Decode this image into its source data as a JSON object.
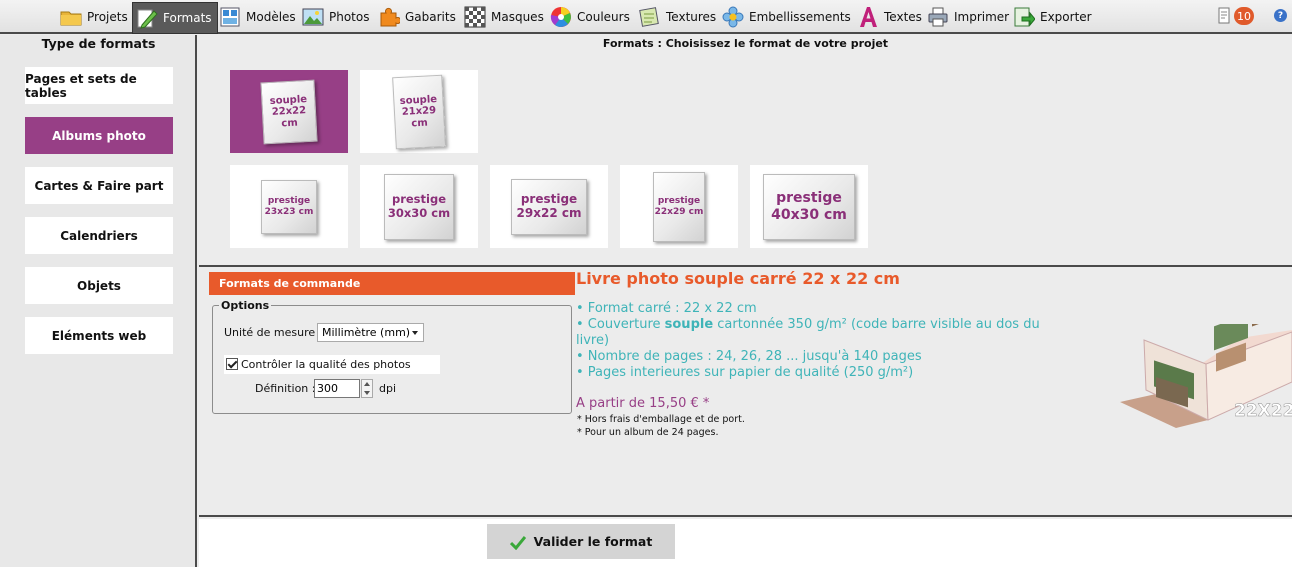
{
  "toolbar": {
    "items": [
      {
        "label": "Projets",
        "icon": "folder-icon"
      },
      {
        "label": "Formats",
        "icon": "formats-pencil-icon",
        "active": true
      },
      {
        "label": "Modèles",
        "icon": "layout-icon"
      },
      {
        "label": "Photos",
        "icon": "picture-icon"
      },
      {
        "label": "Gabarits",
        "icon": "puzzle-icon"
      },
      {
        "label": "Masques",
        "icon": "checkerboard-icon"
      },
      {
        "label": "Couleurs",
        "icon": "color-wheel-icon"
      },
      {
        "label": "Textures",
        "icon": "texture-icon"
      },
      {
        "label": "Embellissements",
        "icon": "flower-icon"
      },
      {
        "label": "Textes",
        "icon": "letter-a-icon"
      },
      {
        "label": "Imprimer",
        "icon": "printer-icon"
      },
      {
        "label": "Exporter",
        "icon": "export-icon"
      }
    ],
    "notifications_count": "10",
    "help_symbol": "?"
  },
  "sidebar": {
    "title": "Type de formats",
    "items": [
      {
        "label": "Pages et sets de tables"
      },
      {
        "label": "Albums photo",
        "active": true
      },
      {
        "label": "Cartes & Faire part"
      },
      {
        "label": "Calendriers"
      },
      {
        "label": "Objets"
      },
      {
        "label": "Eléments web"
      }
    ]
  },
  "formats": {
    "title": "Formats : Choisissez le format de votre projet",
    "items": [
      {
        "line1": "souple",
        "line2": "22x22 cm",
        "selected": true
      },
      {
        "line1": "souple",
        "line2": "21x29 cm"
      },
      {
        "line1": "prestige",
        "line2": "23x23 cm"
      },
      {
        "line1": "prestige",
        "line2": "30x30 cm"
      },
      {
        "line1": "prestige",
        "line2": "29x22 cm"
      },
      {
        "line1": "prestige",
        "line2": "22x29 cm"
      },
      {
        "line1": "prestige",
        "line2": "40x30 cm"
      }
    ]
  },
  "order": {
    "header": "Formats de commande",
    "options_legend": "Options",
    "unit_label": "Unité de mesure :",
    "unit_value": "Millimètre (mm)",
    "quality_check_label": "Contrôler la qualité des photos",
    "quality_checked": true,
    "definition_label": "Définition :",
    "definition_value": "300",
    "definition_unit": "dpi"
  },
  "product": {
    "title": "Livre photo souple carré 22 x 22 cm",
    "features": [
      {
        "pre": "• Format carré : 22 x 22 cm",
        "bold": "",
        "post": ""
      },
      {
        "pre": "• Couverture ",
        "bold": "souple",
        "post": " cartonnée 350 g/m² (code barre visible au dos du livre)"
      },
      {
        "pre": "• Nombre de pages : 24, 26, 28 ... jusqu'à 140 pages",
        "bold": "",
        "post": ""
      },
      {
        "pre": "• Pages interieures sur papier de qualité (250 g/m²)",
        "bold": "",
        "post": ""
      }
    ],
    "price": "A partir de 15,50 € *",
    "note1": "* Hors frais d'emballage et de port.",
    "note2": "* Pour un album de 24 pages.",
    "image_label": "22X22"
  },
  "footer": {
    "validate_label": "Valider le format"
  },
  "colors": {
    "accent_purple": "#973f86",
    "accent_orange": "#e85a2b",
    "feature_teal": "#3fb4b8"
  }
}
